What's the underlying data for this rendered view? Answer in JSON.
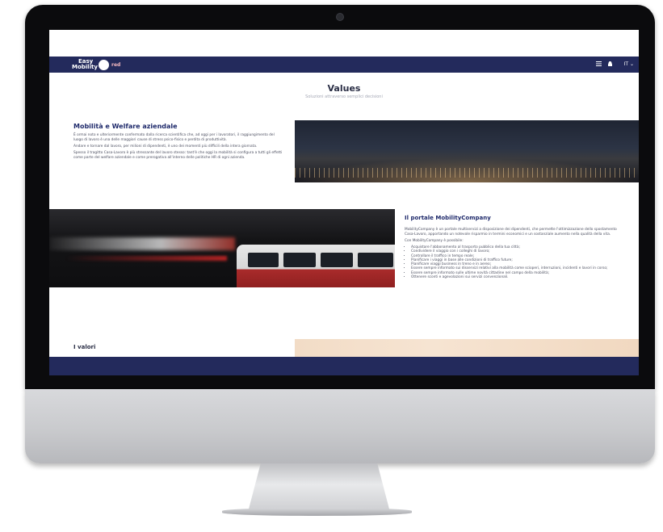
{
  "header": {
    "logo_line1": "Easy",
    "logo_line2": "Mobility",
    "logo_suffix": "red",
    "language": "IT",
    "menu_icon": "menu-icon",
    "user_icon": "user-icon"
  },
  "hero": {
    "title": "Values",
    "subtitle": "Soluzioni attraverso semplici decisioni"
  },
  "section1": {
    "title": "Mobilità e Welfare aziendale",
    "p1": "È ormai noto e ulteriormente confermato dalla ricerca scientifica che, ad oggi per i lavoratori, il raggiungimento del luogo di lavoro è una delle maggiori cause di stress psico-fisico e perdita di produttività.",
    "p2": "Andare e tornare dal lavoro, per milioni di dipendenti, è uno dei momenti più difficili della intera giornata.",
    "p3": "Spesso il tragitto Casa-Lavoro è più stressante del lavoro stesso: tant'è che oggi la mobilità si configura a tutti gli effetti come parte del welfare aziendale e come prerogativa all'interno delle politiche HR di ogni azienda."
  },
  "section2": {
    "title": "Il portale MobilityCompany",
    "p1": "MobilityCompany è un portale multiservizi a disposizione dei dipendenti, che permette l'ottimizzazione dello spostamento Casa-Lavoro, apportando un notevole risparmio in termini economici e un sostanziale aumento nella qualità della vita.",
    "p2": "Con MobilityCompany è possibile:",
    "items": [
      "Acquistare l'abbonamento al trasporto pubblico della tua città;",
      "Condividere il viaggio con i colleghi di lavoro;",
      "Controllare il traffico in tempo reale;",
      "Pianificare i viaggi in base alle condizioni di traffico future;",
      "Pianificare viaggi business in treno e in aereo;",
      "Essere sempre informato sui disservizi relativi alla mobilità come scioperi, interruzioni, incidenti e lavori in corso;",
      "Essere sempre informato sulle ultime novità cittadine nel campo della mobilità;",
      "Ottenere sconti e agevolazioni sui servizi convenzionali."
    ]
  },
  "section3": {
    "title": "I valori"
  }
}
